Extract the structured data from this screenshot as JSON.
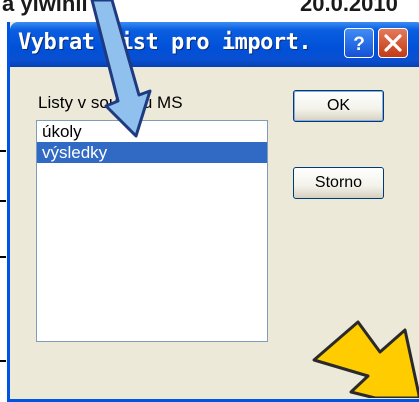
{
  "background": {
    "left_fragment": "a ylwinii",
    "right_fragment": "20.0.2010"
  },
  "dialog": {
    "title": "Vybrat list pro import.",
    "help_symbol": "?",
    "list_label": "Listy v souboru MS",
    "list_items": [
      "úkoly",
      "výsledky"
    ],
    "selected_index": 1,
    "ok_label": "OK",
    "cancel_label": "Storno"
  },
  "annotations": {
    "pointer_arrow_color": "#8fc0ee",
    "pointer_arrow_outline": "#1e3a80",
    "callout_arrow_color": "#ffcc00"
  }
}
